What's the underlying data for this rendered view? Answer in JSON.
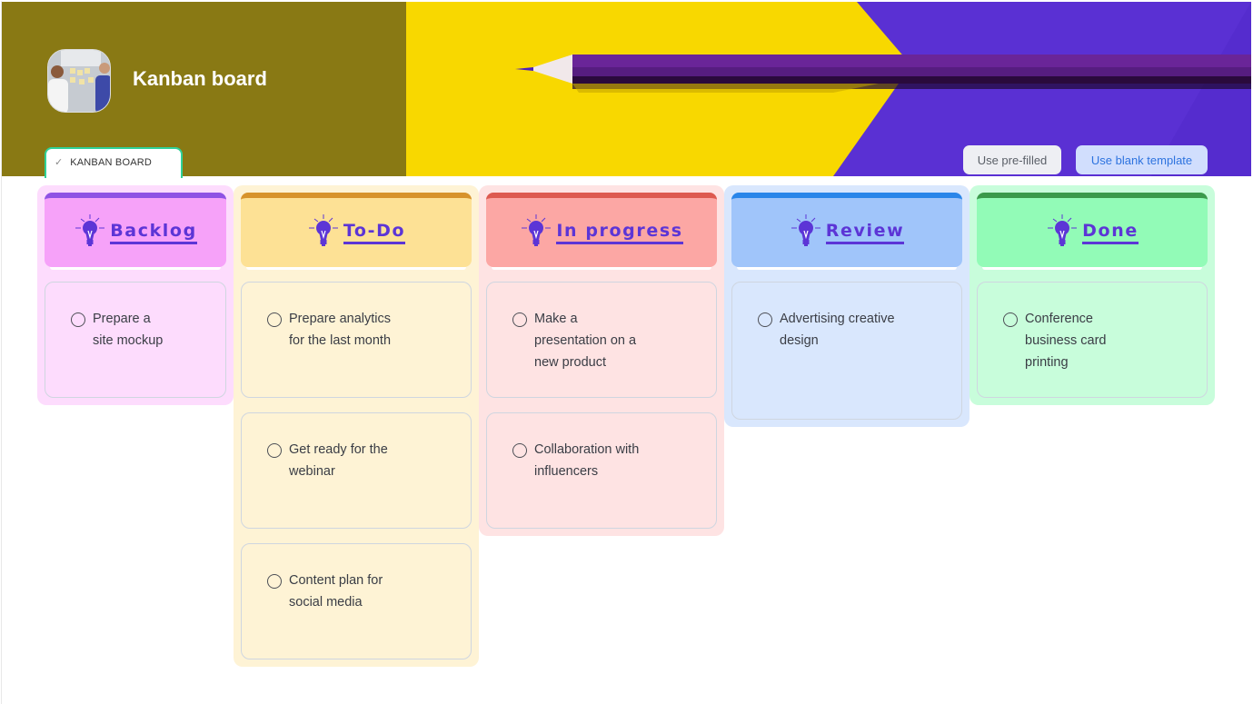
{
  "header": {
    "title": "Kanban board",
    "avatar_icon": "team-photo-icon",
    "tab": {
      "label": "KANBAN BOARD",
      "icon": "check-icon"
    },
    "buttons": {
      "prefilled": "Use pre-filled",
      "blank": "Use blank template"
    }
  },
  "colors": {
    "banner_olive": "#897914",
    "banner_yellow": "#f8d800",
    "banner_purple": "#5a30d3",
    "heading_text": "#5c35d6",
    "tab_border": "#2fd197"
  },
  "columns": [
    {
      "title": "Backlog",
      "icon": "lightbulb-icon",
      "bg": "#fddcfd",
      "head_bg": "#f6a2f9",
      "accent": "#8f52e4",
      "cards": [
        {
          "text_lines": [
            "Prepare a",
            "site mockup"
          ]
        }
      ]
    },
    {
      "title": "To-Do",
      "icon": "lightbulb-icon",
      "bg": "#fef3d5",
      "head_bg": "#fde195",
      "accent": "#d7932c",
      "cards": [
        {
          "text_lines": [
            "Prepare analytics",
            "for the last month"
          ]
        },
        {
          "text_lines": [
            "Get ready for the",
            "webinar"
          ]
        },
        {
          "text_lines": [
            "Content plan for",
            "social media"
          ]
        }
      ]
    },
    {
      "title": "In progress",
      "icon": "lightbulb-icon",
      "bg": "#fee3e3",
      "head_bg": "#fca7a4",
      "accent": "#dd5a50",
      "cards": [
        {
          "text_lines": [
            "Make a",
            "presentation on a",
            "new product"
          ]
        },
        {
          "text_lines": [
            "Collaboration with",
            "influencers"
          ]
        }
      ]
    },
    {
      "title": "Review",
      "icon": "lightbulb-icon",
      "bg": "#d9e7fd",
      "head_bg": "#a0c5fa",
      "accent": "#2a86e9",
      "cards": [
        {
          "text_lines": [
            "Advertising creative",
            "design"
          ]
        }
      ]
    },
    {
      "title": "Done",
      "icon": "lightbulb-icon",
      "bg": "#c8fddb",
      "head_bg": "#92fbb7",
      "accent": "#3a9a4b",
      "cards": [
        {
          "text_lines": [
            "Conference",
            "business card",
            "printing"
          ]
        }
      ]
    }
  ]
}
